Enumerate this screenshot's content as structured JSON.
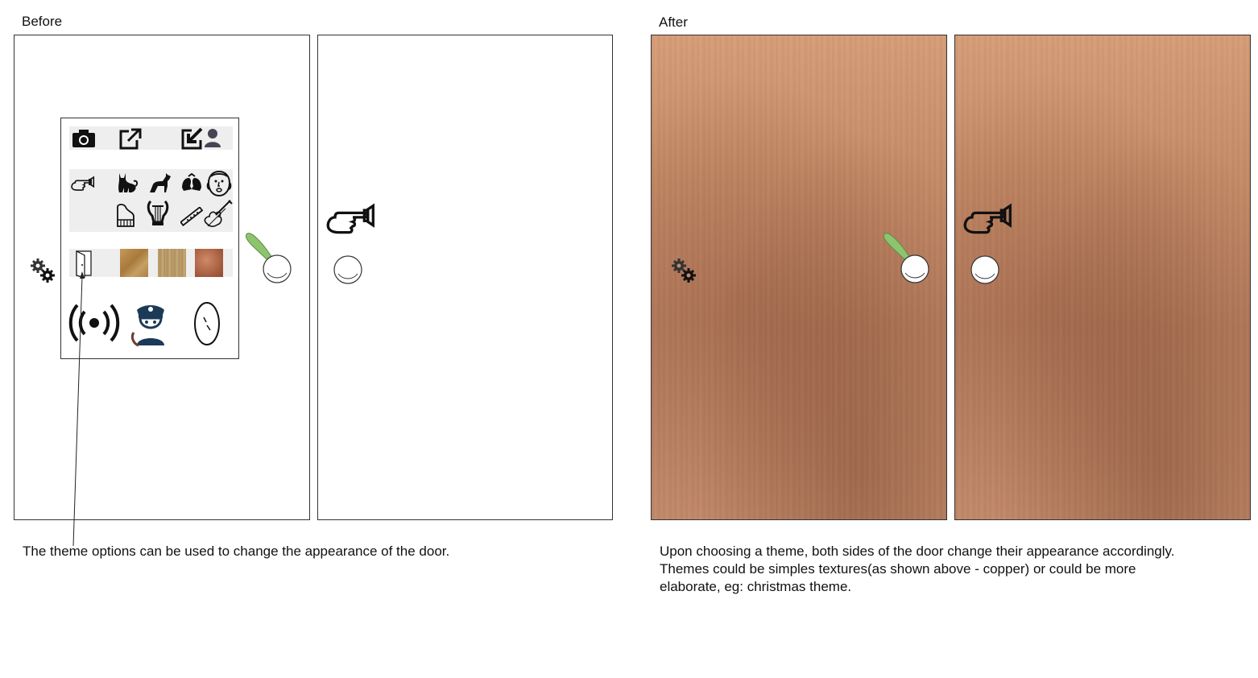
{
  "labels": {
    "before": "Before",
    "after": "After"
  },
  "captions": {
    "before": "The theme options can be used to change the appearance of the door.",
    "after_line1": "Upon choosing a theme, both sides of the door change their appearance accordingly.",
    "after_line2": "Themes could be simples textures(as shown above - copper) or could be more",
    "after_line3": "elaborate, eg: christmas theme."
  },
  "colors": {
    "handle_green": "#8dc46e",
    "police_blue": "#1b3a57",
    "wood_swatch_1": "#b98a4b",
    "wood_swatch_2": "#b99b6a",
    "copper_swatch": "#b06a48"
  },
  "icons": {
    "toolbar": [
      "camera-icon",
      "share-icon",
      "sign-in-icon",
      "user-icon"
    ],
    "sounds": [
      "doorbell-hand-icon",
      "cat-icon",
      "dog-icon",
      "bells-icon",
      "singer-icon",
      "piano-icon",
      "lyre-icon",
      "flute-icon",
      "violin-icon"
    ],
    "themes": [
      "door-icon",
      "wood-texture-1",
      "wood-texture-2",
      "copper-texture"
    ],
    "actions": [
      "broadcast-icon",
      "police-icon",
      "mirror-icon"
    ]
  }
}
